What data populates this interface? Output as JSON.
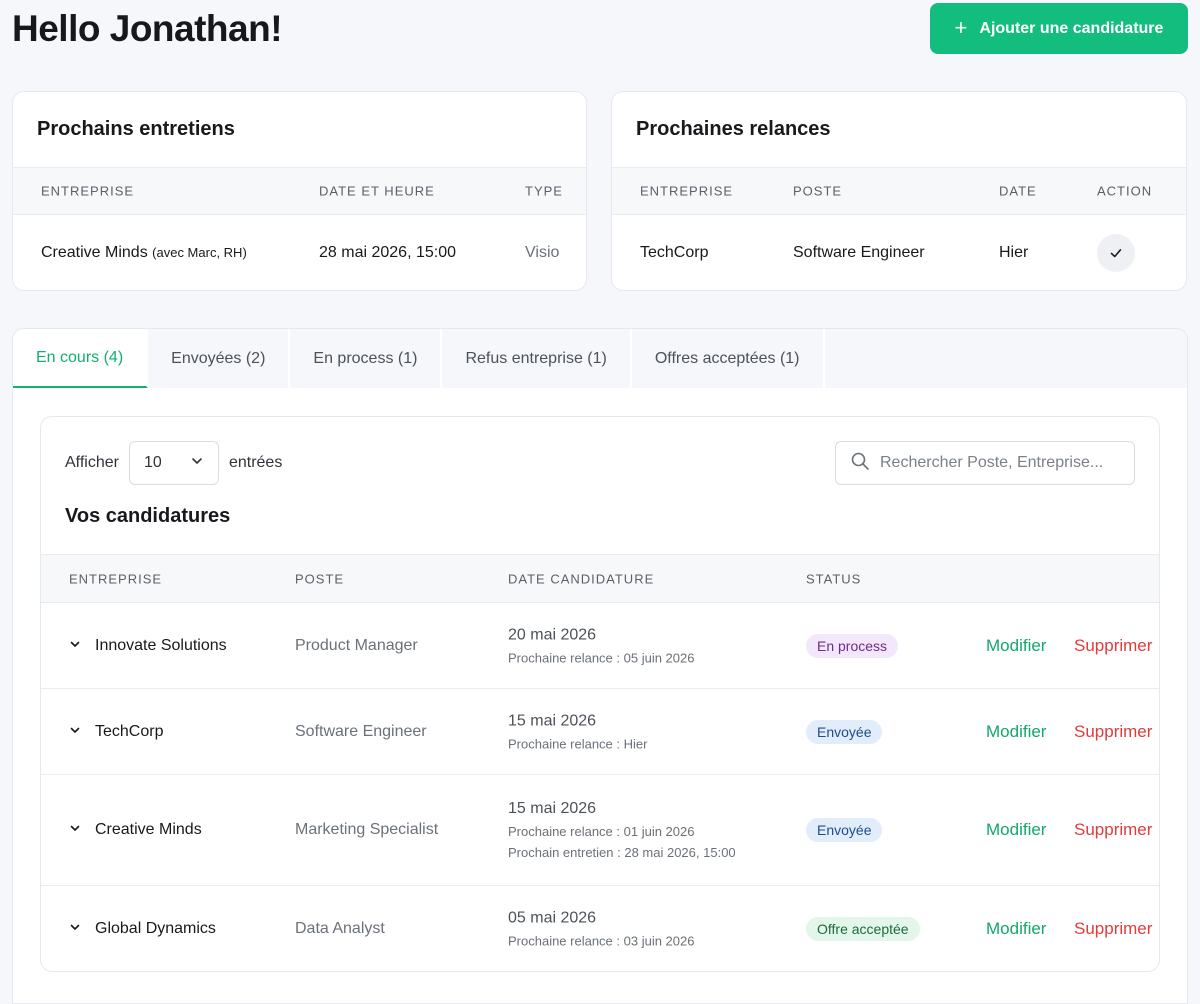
{
  "header": {
    "greeting": "Hello Jonathan!",
    "add_button": "Ajouter une candidature"
  },
  "interviews": {
    "title": "Prochains entretiens",
    "columns": [
      "ENTREPRISE",
      "DATE ET HEURE",
      "TYPE"
    ],
    "rows": [
      {
        "company": "Creative Minds",
        "note": "(avec Marc, RH)",
        "datetime": "28 mai 2026, 15:00",
        "type": "Visio"
      }
    ]
  },
  "followups": {
    "title": "Prochaines relances",
    "columns": [
      "ENTREPRISE",
      "POSTE",
      "DATE",
      "ACTION"
    ],
    "rows": [
      {
        "company": "TechCorp",
        "position": "Software Engineer",
        "date": "Hier"
      }
    ]
  },
  "tabs": [
    {
      "label": "En cours (4)",
      "active": true
    },
    {
      "label": "Envoyées (2)",
      "active": false
    },
    {
      "label": "En process (1)",
      "active": false
    },
    {
      "label": "Refus entreprise (1)",
      "active": false
    },
    {
      "label": "Offres acceptées (1)",
      "active": false
    }
  ],
  "controls": {
    "show_label": "Afficher",
    "page_size": "10",
    "entries_label": "entrées",
    "search_placeholder": "Rechercher Poste, Entreprise..."
  },
  "applications": {
    "title": "Vos candidatures",
    "columns": [
      "ENTREPRISE",
      "POSTE",
      "DATE CANDIDATURE",
      "STATUS"
    ],
    "edit_label": "Modifier",
    "delete_label": "Supprimer",
    "rows": [
      {
        "company": "Innovate Solutions",
        "position": "Product Manager",
        "date": "20 mai 2026",
        "sub1": "Prochaine relance : 05 juin 2026",
        "sub2": "",
        "status": "En process",
        "status_color": "#f3e8fb"
      },
      {
        "company": "TechCorp",
        "position": "Software Engineer",
        "date": "15 mai 2026",
        "sub1": "Prochaine relance : Hier",
        "sub2": "",
        "status": "Envoyée",
        "status_color": "#e1edfb"
      },
      {
        "company": "Creative Minds",
        "position": "Marketing Specialist",
        "date": "15 mai 2026",
        "sub1": "Prochaine relance : 01 juin 2026",
        "sub2": "Prochain entretien : 28 mai 2026, 15:00",
        "status": "Envoyée",
        "status_color": "#e1edfb"
      },
      {
        "company": "Global Dynamics",
        "position": "Data Analyst",
        "date": "05 mai 2026",
        "sub1": "Prochaine relance : 03 juin 2026",
        "sub2": "",
        "status": "Offre acceptée",
        "status_color": "#e2f6e9"
      }
    ]
  }
}
